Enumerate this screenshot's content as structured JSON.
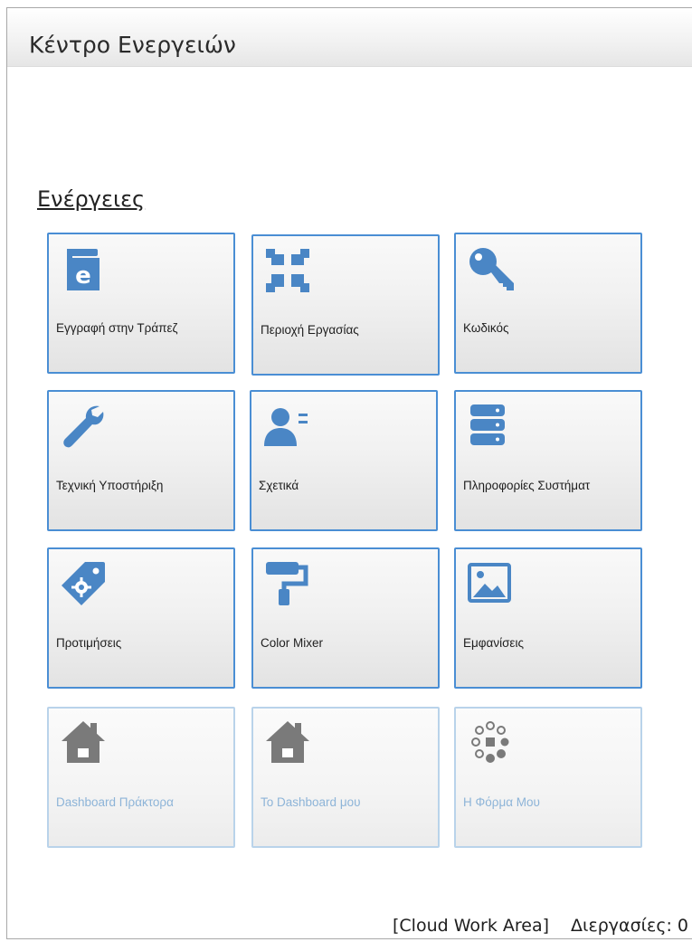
{
  "window": {
    "title": "Κέντρο Ενεργειών"
  },
  "section": {
    "heading": "Ενέργειες"
  },
  "tiles": [
    {
      "label": "Εγγραφή στην Τράπεζ",
      "icon": "book-e-icon",
      "enabled": true
    },
    {
      "label": "Περιοχή Εργασίας",
      "icon": "compress-icon",
      "enabled": true
    },
    {
      "label": "Κωδικός",
      "icon": "key-icon",
      "enabled": true
    },
    {
      "label": "Τεχνική Υποστήριξη",
      "icon": "wrench-icon",
      "enabled": true
    },
    {
      "label": "Σχετικά",
      "icon": "user-list-icon",
      "enabled": true
    },
    {
      "label": "Πληροφορίες Συστήματ",
      "icon": "server-icon",
      "enabled": true
    },
    {
      "label": "Προτιμήσεις",
      "icon": "tag-gear-icon",
      "enabled": true
    },
    {
      "label": "Color Mixer",
      "icon": "paint-roller-icon",
      "enabled": true
    },
    {
      "label": "Εμφανίσεις",
      "icon": "image-icon",
      "enabled": true
    },
    {
      "label": "Dashboard Πράκτορα",
      "icon": "home-icon",
      "enabled": false
    },
    {
      "label": "Το Dashboard μου",
      "icon": "home-icon",
      "enabled": false
    },
    {
      "label": "Η Φόρμα Μου",
      "icon": "spinner-icon",
      "enabled": false
    }
  ],
  "status": {
    "work_area": "[Cloud Work Area]",
    "processes": "Διεργασίες: 0"
  },
  "colors": {
    "accent": "#4a86c5",
    "tile_border": "#4a8ed4",
    "disabled_border": "#b9d3ea",
    "disabled_icon": "#7a7a7a",
    "disabled_text": "#8db4d8"
  }
}
